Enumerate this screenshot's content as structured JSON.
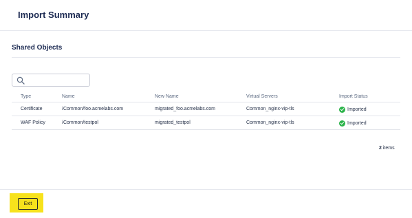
{
  "header": {
    "title": "Import Summary"
  },
  "section": {
    "title": "Shared Objects"
  },
  "search": {
    "placeholder": "",
    "value": ""
  },
  "table": {
    "columns": {
      "type": "Type",
      "name": "Name",
      "new_name": "New Name",
      "virtual_servers": "Virtual Servers",
      "import_status": "Import Status"
    },
    "rows": [
      {
        "type": "Certificate",
        "name": "/Common/foo.acmelabs.com",
        "new_name": "migrated_foo.acmelabs.com",
        "virtual_servers": "Common_nginx-vip-tls",
        "import_status": "Imported"
      },
      {
        "type": "WAF Policy",
        "name": "/Common/testpol",
        "new_name": "migrated_testpol",
        "virtual_servers": "Common_nginx-vip-tls",
        "import_status": "Imported"
      }
    ]
  },
  "pagination": {
    "count": "2",
    "unit": "items"
  },
  "footer": {
    "exit_label": "Exit"
  },
  "colors": {
    "status_success": "#2bb34a",
    "highlight": "#f7e21c",
    "title": "#1c2a52"
  },
  "icons": {
    "search": "search-icon",
    "status": "check-circle-icon"
  }
}
